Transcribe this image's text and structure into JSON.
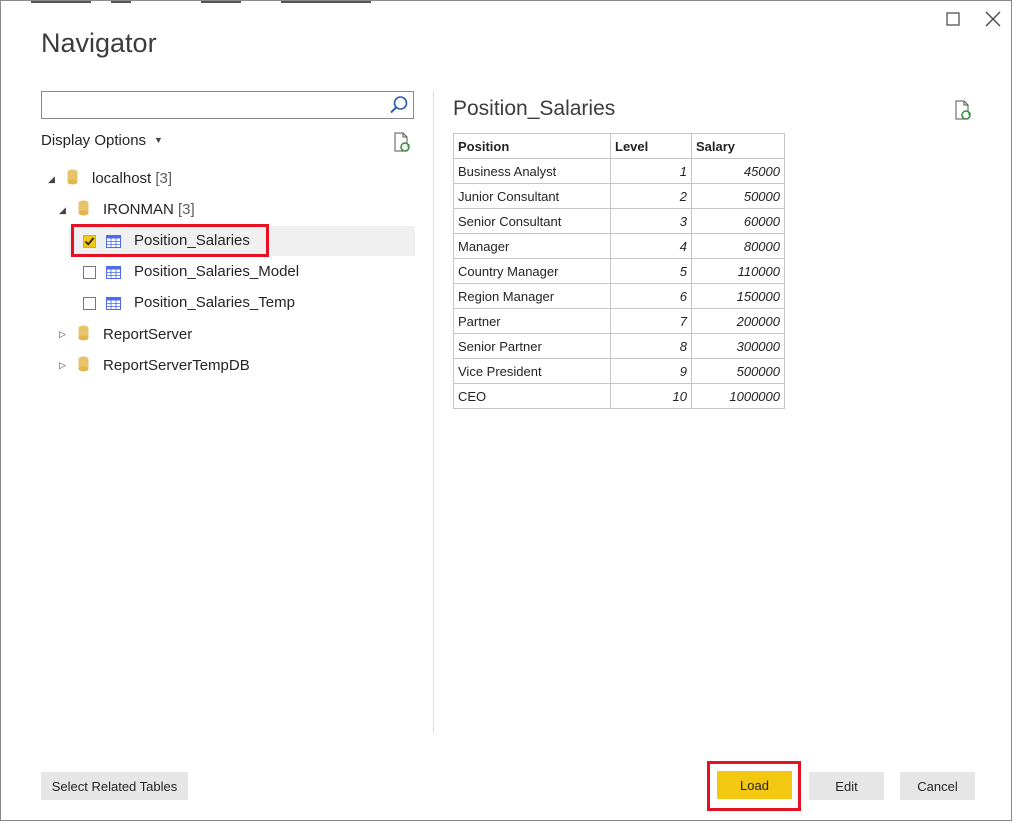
{
  "window": {
    "title": "Navigator"
  },
  "search": {
    "value": "",
    "placeholder": ""
  },
  "display_options": {
    "label": "Display Options"
  },
  "tree": {
    "server": {
      "name": "localhost",
      "count": "[3]"
    },
    "database": {
      "name": "IRONMAN",
      "count": "[3]"
    },
    "tables": [
      {
        "label": "Position_Salaries",
        "checked": true
      },
      {
        "label": "Position_Salaries_Model",
        "checked": false
      },
      {
        "label": "Position_Salaries_Temp",
        "checked": false
      }
    ],
    "other_databases": [
      {
        "label": "ReportServer"
      },
      {
        "label": "ReportServerTempDB"
      }
    ]
  },
  "preview": {
    "title": "Position_Salaries",
    "columns": [
      "Position",
      "Level",
      "Salary"
    ],
    "rows": [
      [
        "Business Analyst",
        "1",
        "45000"
      ],
      [
        "Junior Consultant",
        "2",
        "50000"
      ],
      [
        "Senior Consultant",
        "3",
        "60000"
      ],
      [
        "Manager",
        "4",
        "80000"
      ],
      [
        "Country Manager",
        "5",
        "110000"
      ],
      [
        "Region Manager",
        "6",
        "150000"
      ],
      [
        "Partner",
        "7",
        "200000"
      ],
      [
        "Senior Partner",
        "8",
        "300000"
      ],
      [
        "Vice President",
        "9",
        "500000"
      ],
      [
        "CEO",
        "10",
        "1000000"
      ]
    ]
  },
  "footer": {
    "select_related_label": "Select Related Tables",
    "load_label": "Load",
    "edit_label": "Edit",
    "cancel_label": "Cancel"
  },
  "colors": {
    "accent_yellow": "#f2c811",
    "highlight_red": "#e81123",
    "db_icon": "#e8c36a",
    "table_icon": "#4f6bed"
  },
  "icons": {
    "maximize": "maximize-icon",
    "close": "close-icon",
    "search": "search-icon",
    "refresh": "refresh-document-icon",
    "database": "database-icon",
    "table": "table-icon"
  }
}
